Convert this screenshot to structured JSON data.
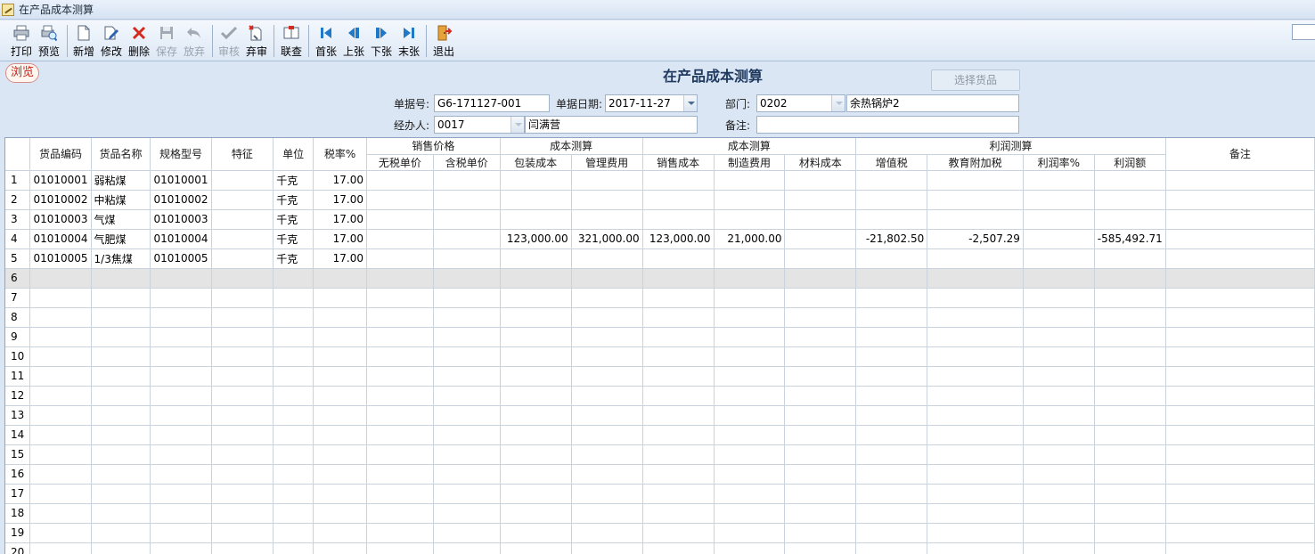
{
  "window": {
    "title": "在产品成本测算"
  },
  "toolbar": {
    "buttons": [
      {
        "label": "打印",
        "icon": "printer-icon",
        "enabled": true
      },
      {
        "label": "预览",
        "icon": "preview-icon",
        "enabled": true
      },
      {
        "label": "新增",
        "icon": "new-document-icon",
        "enabled": true
      },
      {
        "label": "修改",
        "icon": "edit-icon",
        "enabled": true
      },
      {
        "label": "删除",
        "icon": "delete-x-icon",
        "enabled": true
      },
      {
        "label": "保存",
        "icon": "save-disk-icon",
        "enabled": false
      },
      {
        "label": "放弃",
        "icon": "undo-icon",
        "enabled": false
      },
      {
        "label": "审核",
        "icon": "checkmark-icon",
        "enabled": false
      },
      {
        "label": "弃审",
        "icon": "unaudit-icon",
        "enabled": true
      },
      {
        "label": "联查",
        "icon": "linked-query-icon",
        "enabled": true
      },
      {
        "label": "首张",
        "icon": "first-record-icon",
        "enabled": true
      },
      {
        "label": "上张",
        "icon": "previous-record-icon",
        "enabled": true
      },
      {
        "label": "下张",
        "icon": "next-record-icon",
        "enabled": true
      },
      {
        "label": "末张",
        "icon": "last-record-icon",
        "enabled": true
      },
      {
        "label": "退出",
        "icon": "exit-door-icon",
        "enabled": true
      }
    ]
  },
  "form": {
    "status_badge": "浏览",
    "title": "在产品成本测算",
    "select_goods_button": "选择货品",
    "doc_no_label": "单据号:",
    "doc_no_value": "G6-171127-001",
    "doc_date_label": "单据日期:",
    "doc_date_value": "2017-11-27",
    "dept_label": "部门:",
    "dept_code": "0202",
    "dept_name": "余热锅炉2",
    "handler_label": "经办人:",
    "handler_code": "0017",
    "handler_name": "闫满营",
    "remark_label": "备注:",
    "remark_value": ""
  },
  "grid": {
    "group_headers": {
      "sales_price": "销售价格",
      "cost_calc_1": "成本测算",
      "cost_calc_2": "成本测算",
      "profit_calc": "利润测算"
    },
    "columns": {
      "code": "货品编码",
      "name": "货品名称",
      "spec": "规格型号",
      "feature": "特征",
      "unit": "单位",
      "tax_rate": "税率%",
      "price_ex_tax": "无税单价",
      "price_inc_tax": "含税单价",
      "pack_cost": "包装成本",
      "mgmt_fee": "管理费用",
      "sales_cost": "销售成本",
      "mfg_fee": "制造费用",
      "material_cost": "材料成本",
      "vat": "增值税",
      "edu_surcharge": "教育附加税",
      "profit_rate": "利润率%",
      "profit_amount": "利润额",
      "remark": "备注"
    },
    "rows": [
      {
        "rn": "1",
        "cells": [
          "01010001",
          "弱粘煤",
          "01010001",
          "",
          "千克",
          "17.00",
          "",
          "",
          "",
          "",
          "",
          "",
          "",
          "",
          "",
          "",
          "",
          ""
        ]
      },
      {
        "rn": "2",
        "cells": [
          "01010002",
          "中粘煤",
          "01010002",
          "",
          "千克",
          "17.00",
          "",
          "",
          "",
          "",
          "",
          "",
          "",
          "",
          "",
          "",
          "",
          ""
        ]
      },
      {
        "rn": "3",
        "cells": [
          "01010003",
          "气煤",
          "01010003",
          "",
          "千克",
          "17.00",
          "",
          "",
          "",
          "",
          "",
          "",
          "",
          "",
          "",
          "",
          "",
          ""
        ]
      },
      {
        "rn": "4",
        "cells": [
          "01010004",
          "气肥煤",
          "01010004",
          "",
          "千克",
          "17.00",
          "",
          "",
          "123,000.00",
          "321,000.00",
          "123,000.00",
          "21,000.00",
          "",
          "-21,802.50",
          "-2,507.29",
          "",
          "-585,492.71",
          ""
        ]
      },
      {
        "rn": "5",
        "cells": [
          "01010005",
          "1/3焦煤",
          "01010005",
          "",
          "千克",
          "17.00",
          "",
          "",
          "",
          "",
          "",
          "",
          "",
          "",
          "",
          "",
          "",
          ""
        ]
      },
      {
        "rn": "6",
        "cells": [
          "",
          "",
          "",
          "",
          "",
          "",
          "",
          "",
          "",
          "",
          "",
          "",
          "",
          "",
          "",
          "",
          "",
          ""
        ]
      },
      {
        "rn": "7",
        "cells": [
          "",
          "",
          "",
          "",
          "",
          "",
          "",
          "",
          "",
          "",
          "",
          "",
          "",
          "",
          "",
          "",
          "",
          ""
        ]
      },
      {
        "rn": "8",
        "cells": [
          "",
          "",
          "",
          "",
          "",
          "",
          "",
          "",
          "",
          "",
          "",
          "",
          "",
          "",
          "",
          "",
          "",
          ""
        ]
      },
      {
        "rn": "9",
        "cells": [
          "",
          "",
          "",
          "",
          "",
          "",
          "",
          "",
          "",
          "",
          "",
          "",
          "",
          "",
          "",
          "",
          "",
          ""
        ]
      },
      {
        "rn": "10",
        "cells": [
          "",
          "",
          "",
          "",
          "",
          "",
          "",
          "",
          "",
          "",
          "",
          "",
          "",
          "",
          "",
          "",
          "",
          ""
        ]
      },
      {
        "rn": "11",
        "cells": [
          "",
          "",
          "",
          "",
          "",
          "",
          "",
          "",
          "",
          "",
          "",
          "",
          "",
          "",
          "",
          "",
          "",
          ""
        ]
      },
      {
        "rn": "12",
        "cells": [
          "",
          "",
          "",
          "",
          "",
          "",
          "",
          "",
          "",
          "",
          "",
          "",
          "",
          "",
          "",
          "",
          "",
          ""
        ]
      },
      {
        "rn": "13",
        "cells": [
          "",
          "",
          "",
          "",
          "",
          "",
          "",
          "",
          "",
          "",
          "",
          "",
          "",
          "",
          "",
          "",
          "",
          ""
        ]
      },
      {
        "rn": "14",
        "cells": [
          "",
          "",
          "",
          "",
          "",
          "",
          "",
          "",
          "",
          "",
          "",
          "",
          "",
          "",
          "",
          "",
          "",
          ""
        ]
      },
      {
        "rn": "15",
        "cells": [
          "",
          "",
          "",
          "",
          "",
          "",
          "",
          "",
          "",
          "",
          "",
          "",
          "",
          "",
          "",
          "",
          "",
          ""
        ]
      },
      {
        "rn": "16",
        "cells": [
          "",
          "",
          "",
          "",
          "",
          "",
          "",
          "",
          "",
          "",
          "",
          "",
          "",
          "",
          "",
          "",
          "",
          ""
        ]
      },
      {
        "rn": "17",
        "cells": [
          "",
          "",
          "",
          "",
          "",
          "",
          "",
          "",
          "",
          "",
          "",
          "",
          "",
          "",
          "",
          "",
          "",
          ""
        ]
      },
      {
        "rn": "18",
        "cells": [
          "",
          "",
          "",
          "",
          "",
          "",
          "",
          "",
          "",
          "",
          "",
          "",
          "",
          "",
          "",
          "",
          "",
          ""
        ]
      },
      {
        "rn": "19",
        "cells": [
          "",
          "",
          "",
          "",
          "",
          "",
          "",
          "",
          "",
          "",
          "",
          "",
          "",
          "",
          "",
          "",
          "",
          ""
        ]
      },
      {
        "rn": "20",
        "cells": [
          "",
          "",
          "",
          "",
          "",
          "",
          "",
          "",
          "",
          "",
          "",
          "",
          "",
          "",
          "",
          "",
          "",
          ""
        ]
      }
    ],
    "selected_row": "6"
  }
}
